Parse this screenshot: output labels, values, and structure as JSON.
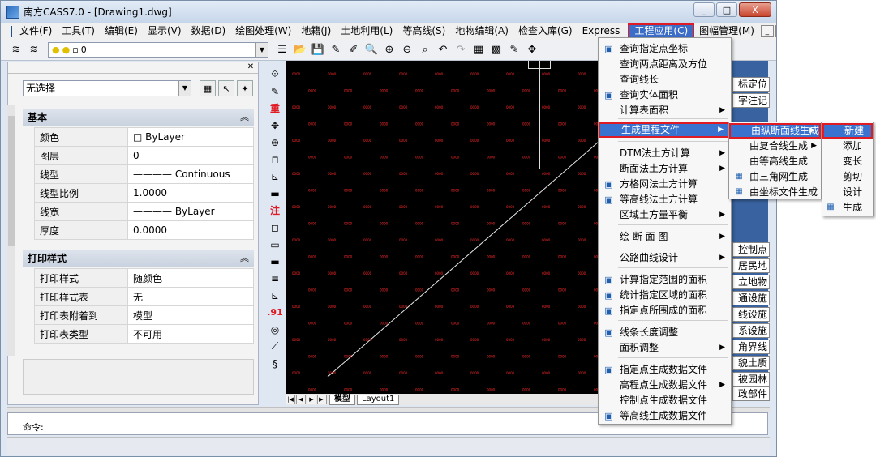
{
  "window": {
    "title": "南方CASS7.0 - [Drawing1.dwg]",
    "min": "_",
    "max": "□",
    "close": "X"
  },
  "menubar": {
    "items": [
      "文件(F)",
      "工具(T)",
      "编辑(E)",
      "显示(V)",
      "数据(D)",
      "绘图处理(W)",
      "地籍(J)",
      "土地利用(L)",
      "等高线(S)",
      "地物编辑(A)",
      "检查入库(G)",
      "Express",
      "工程应用(C)",
      "图幅管理(M)"
    ],
    "active": "工程应用(C)"
  },
  "toolbar": {
    "layer_value": "0"
  },
  "props": {
    "selection": "无选择",
    "sections": {
      "basic": "基本",
      "print": "打印样式"
    },
    "basic_rows": [
      [
        "颜色",
        "□ ByLayer"
      ],
      [
        "图层",
        "0"
      ],
      [
        "线型",
        "———— Continuous"
      ],
      [
        "线型比例",
        "1.0000"
      ],
      [
        "线宽",
        "———— ByLayer"
      ],
      [
        "厚度",
        "0.0000"
      ]
    ],
    "print_rows": [
      [
        "打印样式",
        "随颜色"
      ],
      [
        "打印样式表",
        "无"
      ],
      [
        "打印表附着到",
        "模型"
      ],
      [
        "打印表类型",
        "不可用"
      ]
    ]
  },
  "canvas": {
    "tabs": [
      "模型",
      "Layout1"
    ],
    "point_label": "0000",
    "dot_color": "#ff2a2a"
  },
  "side_tools": [
    "重",
    "注",
    ".91"
  ],
  "command": {
    "prompt": "命令:"
  },
  "right_panel": {
    "items": [
      "标定位",
      "字注记",
      "控制点",
      "居民地",
      "立地物",
      "通设施",
      "线设施",
      "系设施",
      "角界线",
      "貌土质",
      "被园林",
      "政部件"
    ]
  },
  "menu_engineering": {
    "items": [
      {
        "label": "查询指定点坐标",
        "icon": "coord-icon"
      },
      {
        "label": "查询两点距离及方位",
        "icon": ""
      },
      {
        "label": "查询线长",
        "icon": ""
      },
      {
        "label": "查询实体面积",
        "icon": "area-icon"
      },
      {
        "label": "计算表面积",
        "icon": "",
        "sub": true
      },
      {
        "label": "生成里程文件",
        "icon": "",
        "sub": true,
        "hl": true
      },
      {
        "label": "DTM法土方计算",
        "icon": "",
        "sub": true
      },
      {
        "label": "断面法土方计算",
        "icon": "",
        "sub": true
      },
      {
        "label": "方格网法土方计算",
        "icon": "grid-volume-icon"
      },
      {
        "label": "等高线法土方计算",
        "icon": "contour-volume-icon"
      },
      {
        "label": "区域土方量平衡",
        "icon": "",
        "sub": true
      },
      {
        "label": "绘 断 面 图",
        "icon": "",
        "sub": true
      },
      {
        "label": "公路曲线设计",
        "icon": "",
        "sub": true
      },
      {
        "label": "计算指定范围的面积",
        "icon": "range-area-icon"
      },
      {
        "label": "统计指定区域的面积",
        "icon": "stat-area-icon"
      },
      {
        "label": "指定点所围成的面积",
        "icon": "point-area-icon"
      },
      {
        "label": "线条长度调整",
        "icon": "line-adjust-icon"
      },
      {
        "label": "面积调整",
        "icon": "",
        "sub": true
      },
      {
        "label": "指定点生成数据文件",
        "icon": "point-data-icon"
      },
      {
        "label": "高程点生成数据文件",
        "icon": "",
        "sub": true
      },
      {
        "label": "控制点生成数据文件",
        "icon": ""
      },
      {
        "label": "等高线生成数据文件",
        "icon": "contour-data-icon"
      }
    ]
  },
  "menu_mileage": {
    "items": [
      {
        "label": "由纵断面线生成",
        "sub": true,
        "hl": true
      },
      {
        "label": "由复合线生成",
        "sub": true
      },
      {
        "label": "由等高线生成"
      },
      {
        "label": "由三角网生成",
        "icon": "tin-icon"
      },
      {
        "label": "由坐标文件生成",
        "icon": "coordfile-icon"
      }
    ]
  },
  "menu_profile": {
    "items": [
      {
        "label": "新建",
        "hl": true
      },
      {
        "label": "添加"
      },
      {
        "label": "变长"
      },
      {
        "label": "剪切"
      },
      {
        "label": "设计"
      },
      {
        "label": "生成",
        "icon": "generate-icon"
      }
    ]
  }
}
